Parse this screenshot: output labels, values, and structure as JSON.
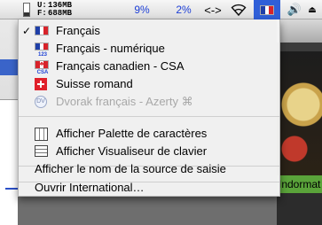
{
  "menubar": {
    "memory": {
      "used_key": "U:",
      "used_value": "136MB",
      "free_key": "F:",
      "free_value": "688MB"
    },
    "cpu1": "9%",
    "cpu2": "2%",
    "arrows": "<->",
    "flag_icon": "flag-france-icon"
  },
  "background": {
    "window_label": "Indormat"
  },
  "menu": {
    "items": [
      {
        "label": "Français",
        "checked": true,
        "icon": "flag-france-icon",
        "enabled": true
      },
      {
        "label": "Français - numérique",
        "checked": false,
        "icon": "flag-france-123-icon",
        "enabled": true,
        "icon_sub": "123"
      },
      {
        "label": "Français canadien - CSA",
        "checked": false,
        "icon": "flag-canada-csa-icon",
        "enabled": true,
        "icon_sub": "CSA"
      },
      {
        "label": "Suisse romand",
        "checked": false,
        "icon": "flag-switzerland-icon",
        "enabled": true
      },
      {
        "label": "Dvorak français - Azerty ⌘",
        "checked": false,
        "icon": "dvorak-icon",
        "enabled": false,
        "icon_text": "DV"
      },
      {
        "label": "Afficher Palette de caractères",
        "icon": "character-palette-icon",
        "enabled": true
      },
      {
        "label": "Afficher Visualiseur de clavier",
        "icon": "keyboard-viewer-icon",
        "enabled": true
      },
      {
        "label": "Afficher le nom de la source de saisie",
        "enabled": true
      },
      {
        "label": "Ouvrir International…",
        "enabled": true
      }
    ],
    "check_glyph": "✓"
  }
}
